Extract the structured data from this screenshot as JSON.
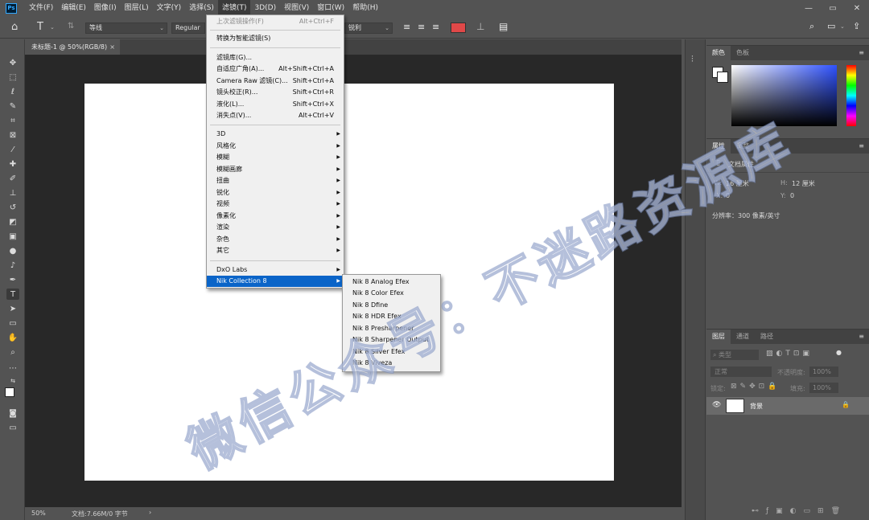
{
  "app": {
    "logo": "Ps"
  },
  "menubar": {
    "items": [
      "文件(F)",
      "编辑(E)",
      "图像(I)",
      "图层(L)",
      "文字(Y)",
      "选择(S)",
      "滤镜(T)",
      "3D(D)",
      "视图(V)",
      "窗口(W)",
      "帮助(H)"
    ],
    "active_index": 6,
    "window_controls": [
      "—",
      "▭",
      "✕"
    ]
  },
  "options": {
    "font_family": "等线",
    "font_style": "Regular",
    "antialias": "锐利",
    "text_color": "#e04848"
  },
  "document_tab": {
    "label": "未标题-1 @ 50%(RGB/8)",
    "close": "×"
  },
  "status": {
    "zoom": "50%",
    "doc_info": "文档:7.66M/0 字节",
    "arrow": "›"
  },
  "filter_menu": {
    "items": [
      {
        "label": "上次滤镜操作(F)",
        "shortcut": "Alt+Ctrl+F",
        "disabled": true
      },
      {
        "label": "转换为智能滤镜(S)",
        "shortcut": ""
      },
      {
        "label": "滤镜库(G)...",
        "shortcut": ""
      },
      {
        "label": "自适应广角(A)...",
        "shortcut": "Alt+Shift+Ctrl+A"
      },
      {
        "label": "Camera Raw 滤镜(C)...",
        "shortcut": "Shift+Ctrl+A"
      },
      {
        "label": "镜头校正(R)...",
        "shortcut": "Shift+Ctrl+R"
      },
      {
        "label": "液化(L)...",
        "shortcut": "Shift+Ctrl+X"
      },
      {
        "label": "消失点(V)...",
        "shortcut": "Alt+Ctrl+V"
      },
      {
        "label": "3D",
        "submenu": true
      },
      {
        "label": "风格化",
        "submenu": true
      },
      {
        "label": "模糊",
        "submenu": true
      },
      {
        "label": "模糊画廊",
        "submenu": true
      },
      {
        "label": "扭曲",
        "submenu": true
      },
      {
        "label": "锐化",
        "submenu": true
      },
      {
        "label": "视频",
        "submenu": true
      },
      {
        "label": "像素化",
        "submenu": true
      },
      {
        "label": "渲染",
        "submenu": true
      },
      {
        "label": "杂色",
        "submenu": true
      },
      {
        "label": "其它",
        "submenu": true
      },
      {
        "label": "DxO Labs",
        "submenu": true
      },
      {
        "label": "Nik Collection 8",
        "submenu": true,
        "highlighted": true
      }
    ]
  },
  "nik_submenu": {
    "items": [
      "Nik 8 Analog Efex",
      "Nik 8 Color Efex",
      "Nik 8 Dfine",
      "Nik 8 HDR Efex",
      "Nik 8 Presharpener",
      "Nik 8 Sharpener Output",
      "Nik 8 Silver Efex",
      "Nik 8 Viveza"
    ]
  },
  "color_panel": {
    "tabs": [
      "颜色",
      "色板"
    ]
  },
  "properties_panel": {
    "tabs": [
      "属性",
      "调整"
    ],
    "title": "文档属性",
    "w_label": "W:",
    "w_value": "16 厘米",
    "h_label": "H:",
    "h_value": "12 厘米",
    "x_label": "X:",
    "x_value": "0",
    "y_label": "Y:",
    "y_value": "0",
    "resolution": "分辨率：300 像素/英寸"
  },
  "layers_panel": {
    "tabs": [
      "图层",
      "通道",
      "路径"
    ],
    "filter_kind": "类型",
    "blend_mode": "正常",
    "opacity_label": "不透明度:",
    "opacity_value": "100%",
    "lock_label": "锁定:",
    "fill_label": "填充:",
    "fill_value": "100%",
    "layer_name": "背景"
  },
  "watermark": {
    "text": "微信公众号：不迷路资源库"
  }
}
